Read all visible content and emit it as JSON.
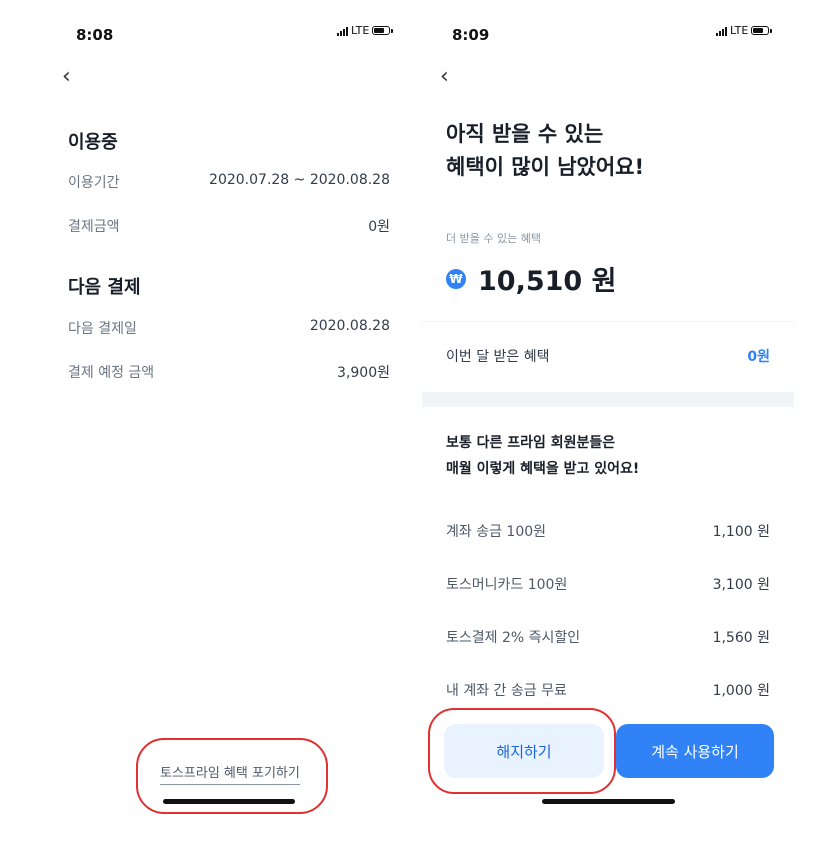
{
  "left": {
    "status_time": "8:08",
    "network": "LTE",
    "in_use": {
      "title": "이용중",
      "period_label": "이용기간",
      "period_value": "2020.07.28 ~ 2020.08.28",
      "paid_label": "결제금액",
      "paid_value": "0원"
    },
    "next_payment": {
      "title": "다음 결제",
      "date_label": "다음 결제일",
      "date_value": "2020.08.28",
      "amount_label": "결제 예정 금액",
      "amount_value": "3,900원"
    },
    "abandon_link": "토스프라임 혜택 포기하기"
  },
  "right": {
    "status_time": "8:09",
    "network": "LTE",
    "headline_line1": "아직 받을 수 있는",
    "headline_line2": "혜택이 많이 남았어요!",
    "more_benefit_label": "더 받을 수 있는 혜택",
    "more_benefit_amount": "10,510 원",
    "coin_symbol": "₩",
    "this_month_label": "이번 달 받은 혜택",
    "this_month_value": "0원",
    "others_title_line1": "보통 다른 프라임 회원분들은",
    "others_title_line2": "매월 이렇게 혜택을 받고 있어요!",
    "benefits": [
      {
        "label": "계좌 송금 100원",
        "value": "1,100 원"
      },
      {
        "label": "토스머니카드 100원",
        "value": "3,100 원"
      },
      {
        "label": "토스결제 2% 즉시할인",
        "value": "1,560 원"
      },
      {
        "label": "내 계좌 간 송금 무료",
        "value": "1,000 원"
      }
    ],
    "cancel_button": "해지하기",
    "continue_button": "계속 사용하기"
  },
  "colors": {
    "accent": "#3182f6",
    "highlight_oval": "#e03030"
  }
}
